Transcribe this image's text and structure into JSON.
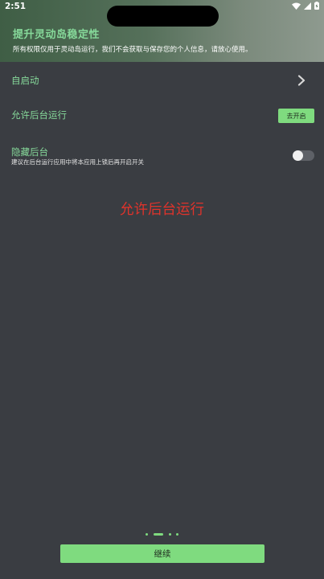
{
  "status_bar": {
    "time": "2:51",
    "icons": [
      "wifi-icon",
      "cellular-signal-icon",
      "battery-charging-icon"
    ]
  },
  "header": {
    "title": "提升灵动岛稳定性",
    "subtitle": "所有权限仅用于灵动岛运行，我们不会获取与保存您的个人信息，请放心使用。"
  },
  "settings": {
    "autostart": {
      "label": "自启动",
      "icon": "chevron-right-icon"
    },
    "background_run": {
      "label": "允许后台运行",
      "button_label": "去开启"
    },
    "hide_background": {
      "label": "隐藏后台",
      "description": "建议在后台运行应用中将本应用上锁后再开启开关",
      "enabled": false
    }
  },
  "overlay_text": "允许后台运行",
  "pager": {
    "page_count": 4,
    "active_index": 1
  },
  "continue_label": "继续",
  "colors": {
    "accent": "#7fdb7f",
    "label_green": "#86d99a",
    "background": "#3a3d42",
    "overlay_red": "#e0332b"
  }
}
